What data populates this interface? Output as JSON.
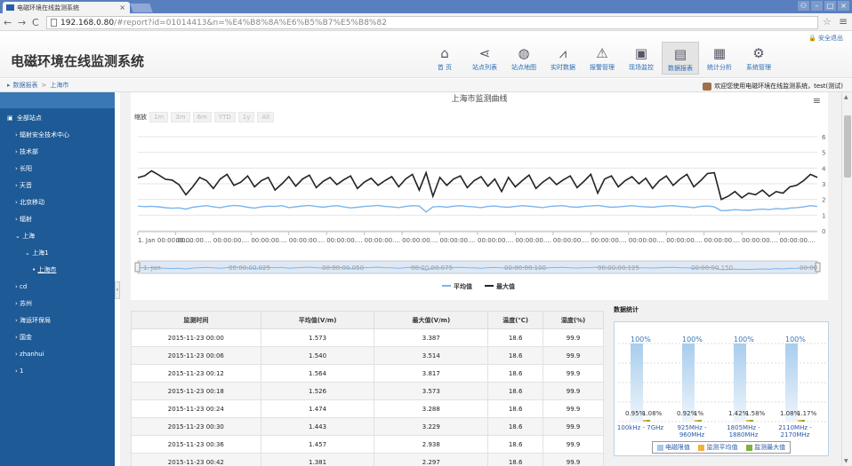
{
  "browser": {
    "tab_title": "电磁环境在线监测系统",
    "url_host": "192.168.0.80",
    "url_path": "/#report?id=01014413&n=%E4%B8%8A%E6%B5%B7%E5%B8%82"
  },
  "header": {
    "title": "电磁环境在线监测系统",
    "logout": "安全退出",
    "nav": [
      {
        "label": "首  页",
        "icon": "home-icon"
      },
      {
        "label": "站点列表",
        "icon": "share-icon"
      },
      {
        "label": "站点地图",
        "icon": "globe-icon"
      },
      {
        "label": "实时数据",
        "icon": "line-chart-icon"
      },
      {
        "label": "报警管理",
        "icon": "warning-icon"
      },
      {
        "label": "现场监控",
        "icon": "image-icon"
      },
      {
        "label": "数据报表",
        "icon": "document-icon",
        "active": true
      },
      {
        "label": "统计分析",
        "icon": "stats-icon"
      },
      {
        "label": "系统管理",
        "icon": "gears-icon"
      }
    ]
  },
  "breadcrumb": {
    "root": "数据报表",
    "current": "上海市"
  },
  "welcome": "欢迎您使用电磁环境在线监测系统，test(测试)",
  "sidebar": {
    "items": [
      {
        "label": "全部站点",
        "level": 0
      },
      {
        "label": "辐射安全技术中心",
        "level": 1
      },
      {
        "label": "技术部",
        "level": 1
      },
      {
        "label": "长阳",
        "level": 1
      },
      {
        "label": "天音",
        "level": 1
      },
      {
        "label": "北京移动",
        "level": 1
      },
      {
        "label": "辐射",
        "level": 1
      },
      {
        "label": "上海",
        "level": 1,
        "expanded": true
      },
      {
        "label": "上海1",
        "level": 2,
        "expanded": true
      },
      {
        "label": "上海市",
        "level": 3,
        "selected": true
      },
      {
        "label": "cd",
        "level": 1
      },
      {
        "label": "苏州",
        "level": 1
      },
      {
        "label": "海运环保局",
        "level": 1
      },
      {
        "label": "国金",
        "level": 1
      },
      {
        "label": "zhanhui",
        "level": 1
      },
      {
        "label": "1",
        "level": 1
      }
    ]
  },
  "chart": {
    "zoom_label": "缩放",
    "zoom_buttons": [
      "1m",
      "3m",
      "6m",
      "YTD",
      "1y",
      "All"
    ],
    "navigator_labels": [
      "1. Jan",
      "00:00:00.025",
      "00:00:00.050",
      "00:00:00.075",
      "00:00:00.100",
      "00:00:00.125",
      "00:00:00.150",
      "00:00"
    ]
  },
  "chart_data": {
    "type": "line",
    "title": "上海市监测曲线",
    "ylim": [
      0,
      6
    ],
    "y_ticks": [
      "0",
      "1",
      "2",
      "3",
      "4",
      "5",
      "6"
    ],
    "x_ticks": [
      "1. Jan 00:00:00....",
      "00:00:00....",
      "00:00:00....",
      "00:00:00....",
      "00:00:00....",
      "00:00:00....",
      "00:00:00....",
      "00:00:00....",
      "00:00:00....",
      "00:00:00....",
      "00:00:00....",
      "00:00:00....",
      "00:00:00....",
      "00:00:00....",
      "00:00:00....",
      "00:00:00....",
      "00:00:00....",
      "00:00:00...."
    ],
    "series": [
      {
        "name": "平均值",
        "color": "#7cb5ec",
        "values": [
          1.57,
          1.54,
          1.56,
          1.53,
          1.47,
          1.44,
          1.46,
          1.38,
          1.5,
          1.55,
          1.6,
          1.52,
          1.48,
          1.56,
          1.62,
          1.58,
          1.5,
          1.45,
          1.52,
          1.57,
          1.55,
          1.6,
          1.48,
          1.53,
          1.58,
          1.62,
          1.55,
          1.5,
          1.57,
          1.6,
          1.52,
          1.46,
          1.5,
          1.55,
          1.58,
          1.62,
          1.55,
          1.52,
          1.48,
          1.55,
          1.6,
          1.58,
          1.2,
          1.52,
          1.55,
          1.5,
          1.57,
          1.6,
          1.55,
          1.52,
          1.48,
          1.55,
          1.58,
          1.52,
          1.5,
          1.55,
          1.6,
          1.57,
          1.52,
          1.48,
          1.55,
          1.58,
          1.6,
          1.52,
          1.5,
          1.55,
          1.58,
          1.62,
          1.55,
          1.5,
          1.52,
          1.56,
          1.6,
          1.55,
          1.52,
          1.5,
          1.55,
          1.58,
          1.6,
          1.55,
          1.52,
          1.48,
          1.55,
          1.58,
          1.52,
          1.28,
          1.3,
          1.35,
          1.32,
          1.3,
          1.35,
          1.38,
          1.35,
          1.42,
          1.38,
          1.45,
          1.48,
          1.52,
          1.6,
          1.55
        ]
      },
      {
        "name": "最大值",
        "color": "#222222",
        "values": [
          3.39,
          3.51,
          3.82,
          3.57,
          3.29,
          3.23,
          2.94,
          2.3,
          2.8,
          3.4,
          3.2,
          2.7,
          3.3,
          3.6,
          2.9,
          3.1,
          3.5,
          2.8,
          3.2,
          3.4,
          2.6,
          3.0,
          3.45,
          2.85,
          3.3,
          3.55,
          2.75,
          3.15,
          3.4,
          2.95,
          3.25,
          3.5,
          2.7,
          3.1,
          3.35,
          2.9,
          3.2,
          3.45,
          2.8,
          3.3,
          3.6,
          2.6,
          3.7,
          2.2,
          3.4,
          2.9,
          3.3,
          3.5,
          2.75,
          3.2,
          3.45,
          2.85,
          3.3,
          2.5,
          3.4,
          2.8,
          3.2,
          3.55,
          2.7,
          3.1,
          3.4,
          2.95,
          3.25,
          3.5,
          2.75,
          3.15,
          3.6,
          2.4,
          3.3,
          3.5,
          2.8,
          3.2,
          3.45,
          3.0,
          3.35,
          2.7,
          3.2,
          3.5,
          2.9,
          3.3,
          3.6,
          2.8,
          3.2,
          3.65,
          3.7,
          2.0,
          2.2,
          2.5,
          2.1,
          2.4,
          2.3,
          2.6,
          2.2,
          2.5,
          2.4,
          2.8,
          2.9,
          3.2,
          3.6,
          3.4
        ]
      }
    ]
  },
  "table": {
    "headers": [
      "监测时间",
      "平均值(V/m)",
      "最大值(V/m)",
      "温度(℃)",
      "湿度(%)"
    ],
    "rows": [
      [
        "2015-11-23 00:00",
        "1.573",
        "3.387",
        "18.6",
        "99.9"
      ],
      [
        "2015-11-23 00:06",
        "1.540",
        "3.514",
        "18.6",
        "99.9"
      ],
      [
        "2015-11-23 00:12",
        "1.564",
        "3.817",
        "18.6",
        "99.9"
      ],
      [
        "2015-11-23 00:18",
        "1.526",
        "3.573",
        "18.6",
        "99.9"
      ],
      [
        "2015-11-23 00:24",
        "1.474",
        "3.288",
        "18.6",
        "99.9"
      ],
      [
        "2015-11-23 00:30",
        "1.443",
        "3.229",
        "18.6",
        "99.9"
      ],
      [
        "2015-11-23 00:36",
        "1.457",
        "2.938",
        "18.6",
        "99.9"
      ],
      [
        "2015-11-23 00:42",
        "1.381",
        "2.297",
        "18.6",
        "99.9"
      ]
    ]
  },
  "stats": {
    "title": "数据统计",
    "bands": [
      {
        "band": "100kHz - 7GHz",
        "limit_pct": "100%",
        "avg_pct": "0.95%",
        "max_pct": "1.08%"
      },
      {
        "band": "925MHz - 960MHz",
        "limit_pct": "100%",
        "avg_pct": "0.92%",
        "max_pct": "1%"
      },
      {
        "band": "1805MHz - 1880MHz",
        "limit_pct": "100%",
        "avg_pct": "1.42%",
        "max_pct": "1.58%"
      },
      {
        "band": "2110MHz - 2170MHz",
        "limit_pct": "100%",
        "avg_pct": "1.08%",
        "max_pct": "1.17%"
      }
    ],
    "legend": [
      {
        "label": "电磁限值",
        "color": "#a8c8e8"
      },
      {
        "label": "监测平均值",
        "color": "#f0b040"
      },
      {
        "label": "监测最大值",
        "color": "#80b040"
      }
    ]
  }
}
